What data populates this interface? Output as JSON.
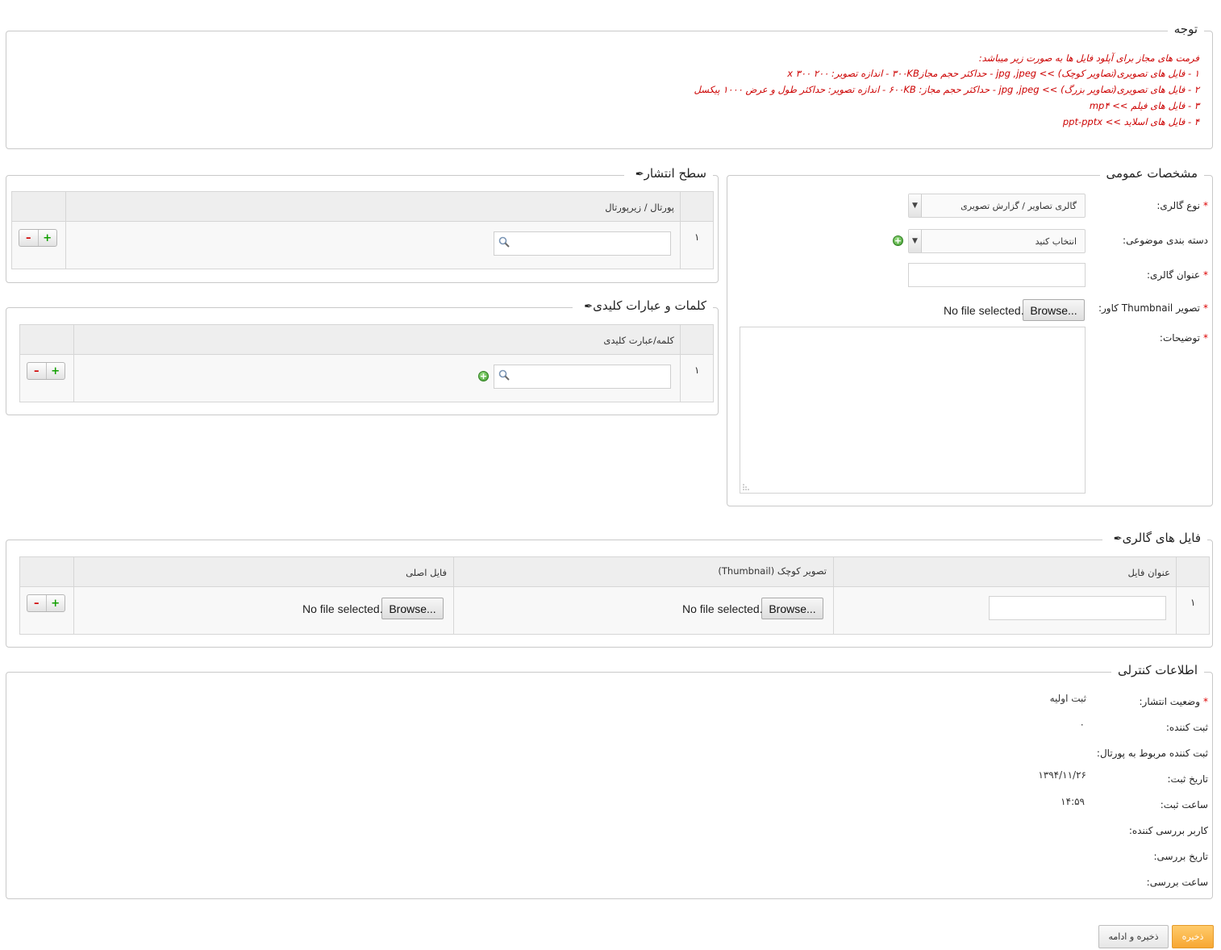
{
  "notice": {
    "legend": "توجه",
    "lines": [
      "فرمت های مجاز برای آپلود فایل ها به صورت زیر میباشد:",
      "۱ - فایل های تصویری(تصاویر کوچک) >> jpg ,jpeg - حداکثر حجم مجاز۳۰۰KB - اندازه تصویر: ۲۰۰ x ۳۰۰",
      "۲ - فایل های تصویری(تصاویر بزرگ) >> jpg ,jpeg - حداکثر حجم مجاز: ۶۰۰KB - اندازه تصویر: حداکثر طول و عرض ۱۰۰۰ پیکسل",
      "۳ - فایل های فیلم >> mp۴",
      "۴ - فایل های اسلاید >> ppt-pptx"
    ]
  },
  "general": {
    "legend": "مشخصات عمومی",
    "gallery_type_label": "نوع گالری:",
    "gallery_type_value": "گالری تصاویر / گزارش تصویری",
    "category_label": "دسته بندی موضوعی:",
    "category_value": "انتخاب کنید",
    "title_label": "عنوان گالری:",
    "title_value": "",
    "thumb_label": "تصویر Thumbnail کاور:",
    "browse_label": "Browse...",
    "no_file": "No file selected.",
    "desc_label": "توضیحات:",
    "desc_value": ""
  },
  "publish": {
    "legend": "سطح انتشار",
    "col_header": "پورتال / زیرپورتال",
    "row_number": "۱",
    "search_value": ""
  },
  "keywords": {
    "legend": "کلمات و عبارات کلیدی",
    "col_header": "کلمه/عبارت کلیدی",
    "row_number": "۱",
    "search_value": ""
  },
  "files": {
    "legend": "فایل های گالری",
    "col_title": "عنوان فایل",
    "col_thumb": "تصویر کوچک (Thumbnail)",
    "col_main": "فایل اصلی",
    "row_number": "۱",
    "title_value": "",
    "browse_label": "Browse...",
    "no_file": "No file selected."
  },
  "control": {
    "legend": "اطلاعات کنترلی",
    "status_label": "وضعیت انتشار:",
    "status_value": "ثبت اولیه",
    "creator_label": "ثبت کننده:",
    "creator_value": "۰",
    "creator_portal_label": "ثبت کننده مربوط به پورتال:",
    "date_label": "تاریخ ثبت:",
    "date_value": "۱۳۹۴/۱۱/۲۶",
    "time_label": "ساعت ثبت:",
    "time_value": "۱۴:۵۹",
    "reviewer_label": "کاربر بررسی کننده:",
    "review_date_label": "تاریخ بررسی:",
    "review_time_label": "ساعت بررسی:"
  },
  "actions": {
    "save": "ذخیره",
    "save_continue": "ذخیره و ادامه"
  },
  "colors": {
    "accent_orange": "#f7a733",
    "notice_red": "#cc0000",
    "required_red": "#dd0000",
    "add_green": "#3c9a2a"
  },
  "icons": [
    "pencil-icon",
    "search-icon",
    "add-icon",
    "remove-icon",
    "chevron-down-icon",
    "resize-handle-icon"
  ]
}
